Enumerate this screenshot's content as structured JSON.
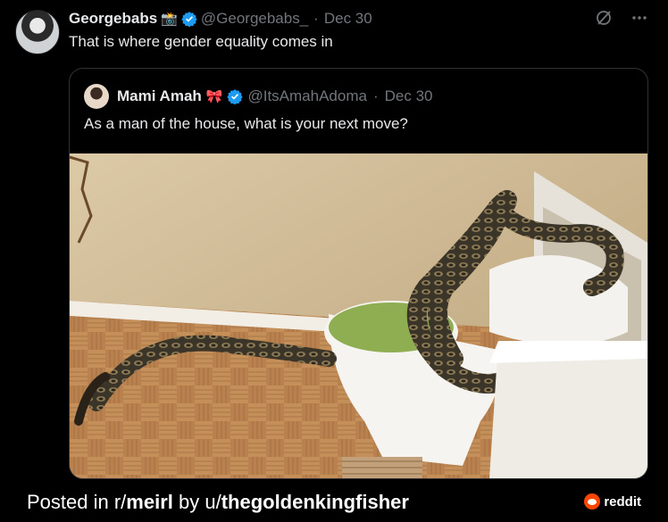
{
  "tweet": {
    "author_name": "Georgebabs",
    "author_emoji": "📸",
    "handle": "@Georgebabs_",
    "date": "Dec 30",
    "text": "That is where gender equality comes in"
  },
  "quoted": {
    "author_name": "Mami Amah",
    "author_emoji": "🎀",
    "handle": "@ItsAmahAdoma",
    "date": "Dec 30",
    "text": "As a man of the house, what is your next move?"
  },
  "footer": {
    "prefix": "Posted in r/",
    "subreddit": "meirl",
    "by": " by u/",
    "user": "thegoldenkingfisher",
    "brand": "reddit"
  },
  "icons": {
    "verified": "verified-badge-icon",
    "grok": "grok-icon",
    "more": "more-icon",
    "reddit": "reddit-logo-icon"
  },
  "colors": {
    "verified": "#1d9bf0",
    "muted": "#71767b",
    "reddit": "#ff4500"
  }
}
